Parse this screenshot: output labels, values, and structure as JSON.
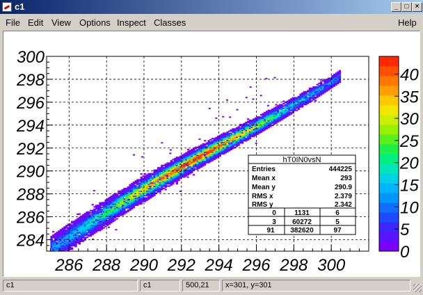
{
  "window": {
    "title": "c1",
    "minimize": "_",
    "maximize": "□",
    "close": "×"
  },
  "menu": {
    "file": "File",
    "edit": "Edit",
    "view": "View",
    "options": "Options",
    "inspect": "Inspect",
    "classes": "Classes",
    "help": "Help"
  },
  "status": {
    "cell1": "c1",
    "cell2": "c1",
    "cell3": "500,21",
    "cell4": "x=301, y=301"
  },
  "chart_data": {
    "type": "heatmap",
    "x_ticks": [
      "286",
      "288",
      "290",
      "292",
      "294",
      "296",
      "298",
      "300"
    ],
    "y_ticks": [
      "284",
      "286",
      "288",
      "290",
      "292",
      "294",
      "296",
      "298",
      "300"
    ],
    "xlim": [
      284.8,
      302
    ],
    "ylim": [
      283,
      300
    ],
    "grid": true,
    "colorbar": {
      "ticks": [
        "0",
        "5",
        "10",
        "15",
        "20",
        "25",
        "30",
        "35",
        "40"
      ],
      "range": [
        0,
        44
      ],
      "colors": [
        "#7a00ff",
        "#5b14ff",
        "#3a28ff",
        "#1e4bff",
        "#0f70ff",
        "#0096ff",
        "#00b6ff",
        "#00d2e6",
        "#00e6b4",
        "#00f080",
        "#1ef048",
        "#5af01e",
        "#96f000",
        "#c8f000",
        "#f0e600",
        "#ffc800",
        "#ffa000",
        "#ff7800",
        "#ff5000",
        "#ff2800"
      ]
    },
    "diagonal_band": {
      "x_from": 285,
      "x_to": 300.5,
      "peak": 44
    },
    "stats": {
      "name": "hT0IN0vsN",
      "rows": [
        {
          "label": "Entries",
          "value": "444225"
        },
        {
          "label": "Mean x",
          "value": "293"
        },
        {
          "label": "Mean y",
          "value": "290.9"
        },
        {
          "label": "RMS x",
          "value": "2.379"
        },
        {
          "label": "RMS y",
          "value": "2.342"
        }
      ],
      "grid": [
        [
          "0",
          "1131",
          "6"
        ],
        [
          "3",
          "60272",
          "5"
        ],
        [
          "91",
          "382620",
          "97"
        ]
      ]
    }
  }
}
